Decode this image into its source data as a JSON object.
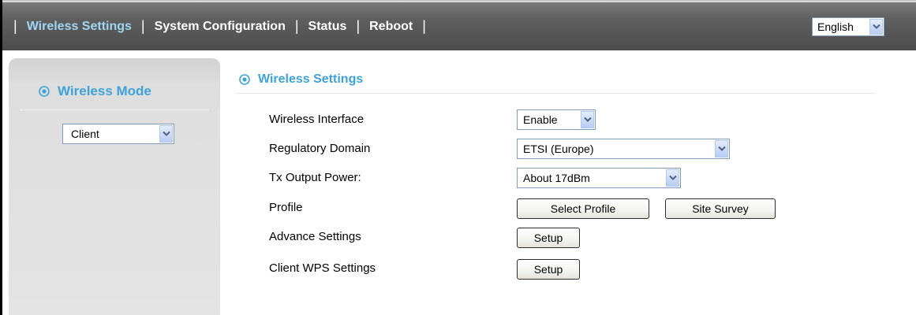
{
  "nav": {
    "items": [
      {
        "label": "Wireless Settings",
        "active": true
      },
      {
        "label": "System Configuration",
        "active": false
      },
      {
        "label": "Status",
        "active": false
      },
      {
        "label": "Reboot",
        "active": false
      }
    ],
    "separator": "|"
  },
  "language": {
    "selected": "English"
  },
  "sidebar": {
    "title": "Wireless Mode",
    "title_icon": "target-circle-icon",
    "mode_selected": "Client"
  },
  "main": {
    "title": "Wireless Settings",
    "title_icon": "target-circle-icon",
    "rows": [
      {
        "label": "Wireless Interface",
        "control": "select",
        "value": "Enable"
      },
      {
        "label": "Regulatory Domain",
        "control": "select",
        "value": "ETSI (Europe)"
      },
      {
        "label": "Tx Output Power:",
        "control": "select",
        "value": "About 17dBm"
      },
      {
        "label": "Profile",
        "control": "buttons",
        "buttons": [
          "Select Profile",
          "Site Survey"
        ]
      },
      {
        "label": "Advance Settings",
        "control": "button",
        "buttons": [
          "Setup"
        ]
      },
      {
        "label": "Client WPS Settings",
        "control": "button",
        "buttons": [
          "Setup"
        ]
      }
    ]
  },
  "colors": {
    "accent": "#3ea3d8",
    "active_nav": "#9fd6f2",
    "topbar": "#5a5a5a",
    "sidebar_bg": "#e2e2e2"
  }
}
